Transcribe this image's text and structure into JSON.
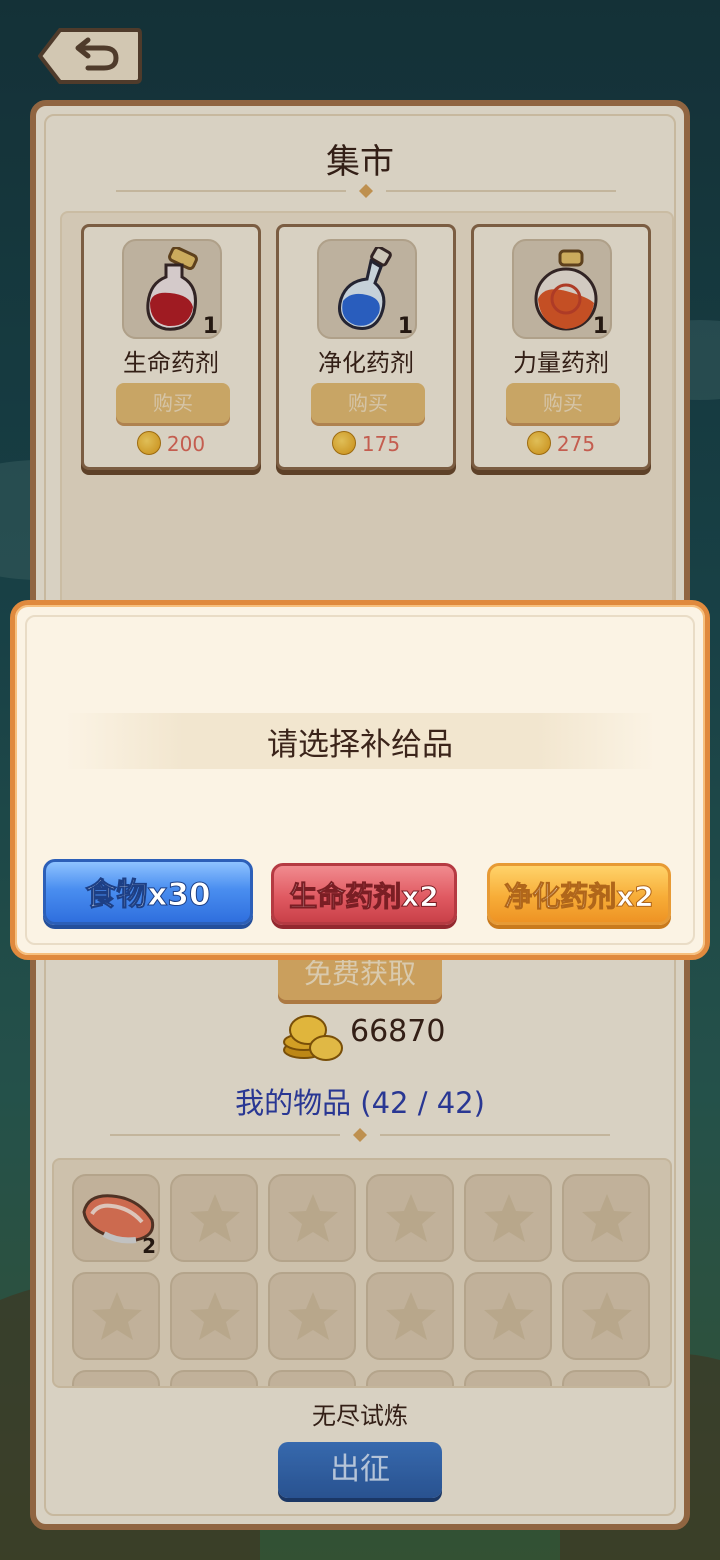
{
  "market": {
    "title": "集市",
    "items": [
      {
        "name": "生命药剂",
        "qty": "1",
        "buy_label": "购买",
        "price": "200",
        "icon": "red-potion-icon"
      },
      {
        "name": "净化药剂",
        "qty": "1",
        "buy_label": "购买",
        "price": "175",
        "icon": "blue-potion-icon"
      },
      {
        "name": "力量药剂",
        "qty": "1",
        "buy_label": "购买",
        "price": "275",
        "icon": "orange-potion-icon"
      }
    ]
  },
  "free_button_label": "免费获取",
  "coins": "66870",
  "inventory": {
    "title": "我的物品 (42 / 42)",
    "first_item_qty": "2",
    "first_item_icon": "salmon-steak-icon"
  },
  "mode_label": "无尽试炼",
  "go_button_label": "出征",
  "dialog": {
    "message": "请选择补给品",
    "options": [
      "食物x30",
      "生命药剂x2",
      "净化药剂x2"
    ]
  },
  "colors": {
    "panel_border": "#a4744a",
    "dialog_border": "#e08a3e",
    "food_button": "#4a8ef0",
    "life_button": "#e05a62",
    "purify_button": "#f7ad38"
  }
}
